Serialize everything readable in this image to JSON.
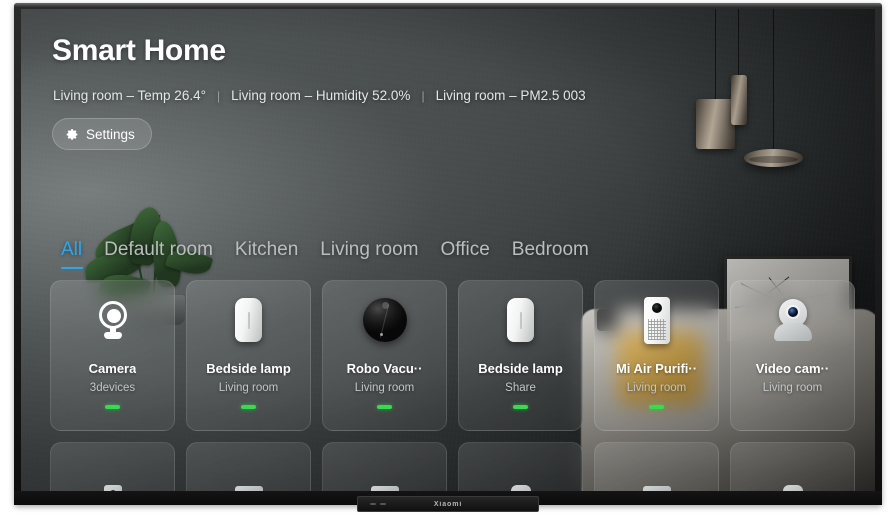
{
  "device": {
    "brand_mark": "Xiaomi"
  },
  "header": {
    "title": "Smart Home",
    "separator": "|",
    "status_items": [
      "Living room – Temp 26.4°",
      "Living room – Humidity 52.0%",
      "Living room – PM2.5 003"
    ],
    "settings_label": "Settings",
    "settings_icon": "gear-icon"
  },
  "tabs": [
    {
      "label": "All",
      "active": true
    },
    {
      "label": "Default room",
      "active": false
    },
    {
      "label": "Kitchen",
      "active": false
    },
    {
      "label": "Living room",
      "active": false
    },
    {
      "label": "Office",
      "active": false
    },
    {
      "label": "Bedroom",
      "active": false
    }
  ],
  "devices": [
    {
      "title": "Camera",
      "subtitle": "3devices",
      "icon": "camera-icon",
      "online": true
    },
    {
      "title": "Bedside lamp",
      "subtitle": "Living room",
      "icon": "lamp-icon",
      "online": true
    },
    {
      "title": "Robo Vacu··",
      "subtitle": "Living room",
      "icon": "vacuum-icon",
      "online": true
    },
    {
      "title": "Bedside lamp",
      "subtitle": "Share",
      "icon": "lamp-icon",
      "online": true
    },
    {
      "title": "Mi Air Purifi··",
      "subtitle": "Living room",
      "icon": "purifier-icon",
      "online": true
    },
    {
      "title": "Video cam··",
      "subtitle": "Living room",
      "icon": "video-cam-icon",
      "online": false
    }
  ],
  "devices_row2": [
    {
      "icon": "small-camera-icon"
    },
    {
      "icon": "small-panel-icon"
    },
    {
      "icon": "small-rect-icon"
    },
    {
      "icon": "small-round-icon"
    },
    {
      "icon": "small-panel-icon"
    },
    {
      "icon": "small-rect-icon"
    }
  ],
  "colors": {
    "accent": "#29a8f2",
    "online_indicator": "#2ee04a",
    "title_text": "#ffffff",
    "subtitle_text": "#c3c7c7",
    "tab_inactive": "#b9bebe"
  }
}
